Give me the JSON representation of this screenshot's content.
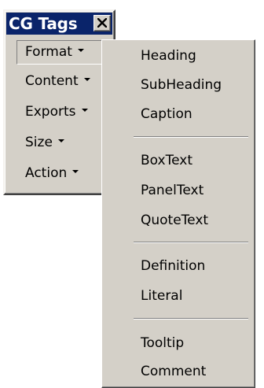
{
  "window": {
    "title": "CG Tags",
    "close_icon": "close-icon"
  },
  "toolbar": {
    "items": [
      {
        "label": "Format",
        "icon": "dropdown-arrow-icon",
        "active": true
      },
      {
        "label": "Content",
        "icon": "dropdown-arrow-icon",
        "active": false
      },
      {
        "label": "Exports",
        "icon": "dropdown-arrow-icon",
        "active": false
      },
      {
        "label": "Size",
        "icon": "dropdown-arrow-icon",
        "active": false
      },
      {
        "label": "Action",
        "icon": "dropdown-arrow-icon",
        "active": false
      }
    ]
  },
  "menu": {
    "groups": [
      [
        "Heading",
        "SubHeading",
        "Caption"
      ],
      [
        "BoxText",
        "PanelText",
        "QuoteText"
      ],
      [
        "Definition",
        "Literal"
      ],
      [
        "Tooltip",
        "Comment"
      ]
    ]
  },
  "colors": {
    "face": "#d4d0c8",
    "titlebar": "#0a246a",
    "shadow": "#808080",
    "highlight": "#ffffff"
  }
}
